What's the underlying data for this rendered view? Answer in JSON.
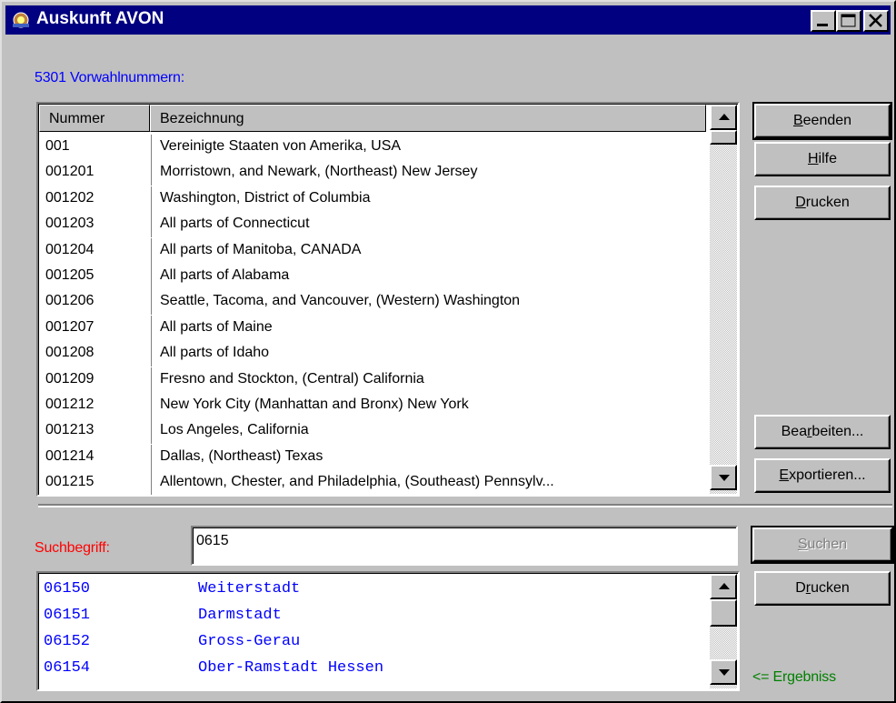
{
  "window": {
    "title": "Auskunft AVON",
    "icon": "phone-book-icon",
    "controls": [
      "minimize-icon",
      "maximize-icon",
      "close-icon"
    ]
  },
  "count_label": "5301 Vorwahlnummern:",
  "table": {
    "columns": [
      "Nummer",
      "Bezeichnung"
    ],
    "rows": [
      {
        "number": "001",
        "name": "Vereinigte Staaten von Amerika, USA"
      },
      {
        "number": "001201",
        "name": "Morristown, and Newark, (Northeast) New Jersey"
      },
      {
        "number": "001202",
        "name": "Washington, District of Columbia"
      },
      {
        "number": "001203",
        "name": "All parts of Connecticut"
      },
      {
        "number": "001204",
        "name": "All parts of Manitoba, CANADA"
      },
      {
        "number": "001205",
        "name": "All parts of Alabama"
      },
      {
        "number": "001206",
        "name": "Seattle, Tacoma, and Vancouver, (Western) Washington"
      },
      {
        "number": "001207",
        "name": "All parts of Maine"
      },
      {
        "number": "001208",
        "name": "All parts of Idaho"
      },
      {
        "number": "001209",
        "name": "Fresno and Stockton, (Central) California"
      },
      {
        "number": "001212",
        "name": "New York City (Manhattan and Bronx) New York"
      },
      {
        "number": "001213",
        "name": "Los Angeles, California"
      },
      {
        "number": "001214",
        "name": "Dallas, (Northeast) Texas"
      },
      {
        "number": "001215",
        "name": "Allentown, Chester, and Philadelphia, (Southeast) Pennsylv..."
      }
    ]
  },
  "buttons": {
    "beenden": {
      "pre": "",
      "acc": "B",
      "post": "eenden"
    },
    "hilfe": {
      "pre": "",
      "acc": "H",
      "post": "ilfe"
    },
    "drucken_top": {
      "pre": "",
      "acc": "D",
      "post": "rucken"
    },
    "bearbeiten": {
      "pre": "Bea",
      "acc": "r",
      "post": "beiten..."
    },
    "exportieren": {
      "pre": "",
      "acc": "E",
      "post": "xportieren..."
    },
    "suchen": {
      "pre": "",
      "acc": "S",
      "post": "uchen"
    },
    "drucken_bottom": {
      "pre": "D",
      "acc": "r",
      "post": "ucken"
    }
  },
  "search": {
    "label": "Suchbegriff:",
    "value": "0615"
  },
  "results": {
    "rows": [
      {
        "number": "06150",
        "name": "Weiterstadt"
      },
      {
        "number": "06151",
        "name": "Darmstadt"
      },
      {
        "number": "06152",
        "name": "Gross-Gerau"
      },
      {
        "number": "06154",
        "name": "Ober-Ramstadt Hessen"
      }
    ],
    "hint": "<= Ergebniss"
  },
  "colors": {
    "titlebar": "#000080",
    "count_label": "#0000ff",
    "search_label": "#ff0000",
    "result_text": "#0000ff",
    "hint": "#008000"
  }
}
